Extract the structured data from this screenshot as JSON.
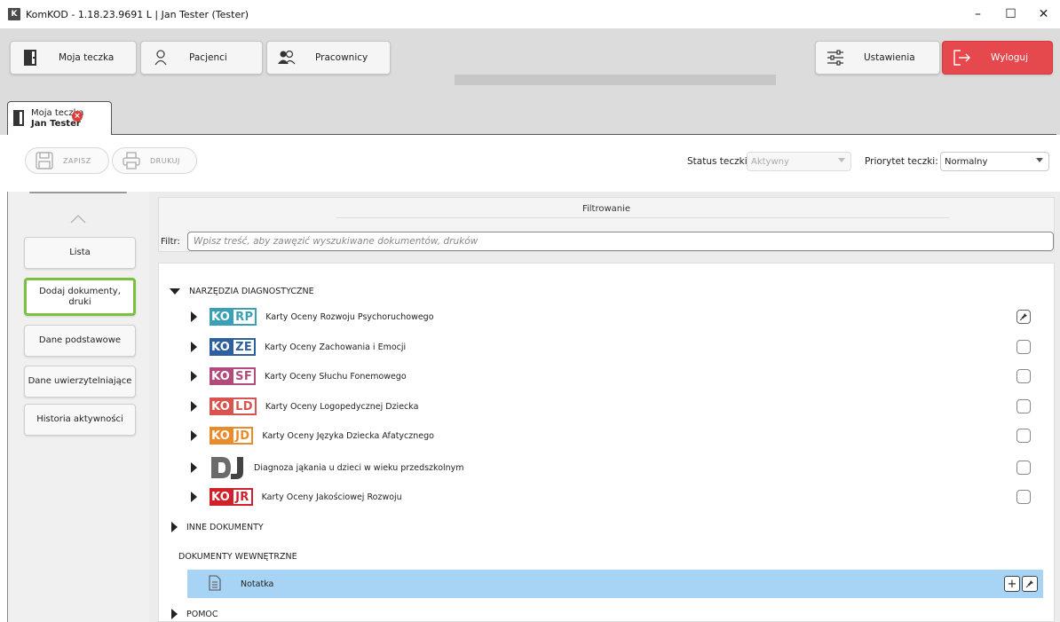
{
  "window": {
    "logo_letter": "K",
    "title": "KomKOD - 1.18.23.9691 L | Jan Tester (Tester)",
    "minimize": "–",
    "maximize": "☐",
    "close": "✕"
  },
  "nav": {
    "folder_label": "Moja teczka",
    "patients_label": "Pacjenci",
    "workers_label": "Pracownicy",
    "settings_label": "Ustawienia",
    "logout_label": "Wyloguj"
  },
  "tab": {
    "line1": "Moja teczka",
    "line2": "Jan Tester",
    "close_glyph": "×"
  },
  "toolbar": {
    "save_label": "ZAPISZ",
    "print_label": "DRUKUJ",
    "status_label": "Status teczki",
    "status_value": "Aktywny",
    "priority_label": "Priorytet teczki:",
    "priority_value": "Normalny"
  },
  "sidebar": {
    "items": [
      {
        "label": "Lista"
      },
      {
        "label": "Dodaj dokumenty, druki"
      },
      {
        "label": "Dane podstawowe"
      },
      {
        "label": "Dane uwierzytelniające"
      },
      {
        "label": "Historia aktywności"
      }
    ]
  },
  "filter": {
    "title": "Filtrowanie",
    "label": "Filtr:",
    "placeholder": "Wpisz treść, aby zawęzić wyszukiwane dokumentów, druków"
  },
  "tree": {
    "section_diag": "NARZĘDZIA DIAGNOSTYCZNE",
    "items": [
      {
        "b1": "KO",
        "b2": "RP",
        "color": "#3aa0b5",
        "label": "Karty Oceny Rozwoju Psychoruchowego",
        "control": "pin"
      },
      {
        "b1": "KO",
        "b2": "ZE",
        "color": "#2e5f9e",
        "label": "Karty Oceny Zachowania i Emocji",
        "control": "checkbox"
      },
      {
        "b1": "KO",
        "b2": "SF",
        "color": "#b04b7c",
        "label": "Karty Oceny Słuchu Fonemowego",
        "control": "checkbox"
      },
      {
        "b1": "KO",
        "b2": "LD",
        "color": "#d9534f",
        "label": "Karty Oceny Logopedycznej Dziecka",
        "control": "checkbox"
      },
      {
        "b1": "KO",
        "b2": "JD",
        "color": "#e98b2a",
        "label": "Karty Oceny Języka Dziecka Afatycznego",
        "control": "checkbox"
      },
      {
        "b1": "DJ",
        "b2": "",
        "color": "#555555",
        "label": "Diagnoza jąkania u dzieci w wieku przedszkolnym",
        "control": "checkbox"
      },
      {
        "b1": "KO",
        "b2": "JR",
        "color": "#d0202a",
        "label": "Karty Oceny Jakościowej Rozwoju",
        "control": "checkbox"
      }
    ],
    "section_other": "INNE DOKUMENTY",
    "section_internal": "DOKUMENTY WEWNĘTRZNE",
    "note_label": "Notatka",
    "note_add": "+",
    "section_help": "POMOC"
  },
  "colors": {
    "accent_green": "#7ac142",
    "logout_red": "#e5484d",
    "selection_blue": "#a7d3f5"
  }
}
